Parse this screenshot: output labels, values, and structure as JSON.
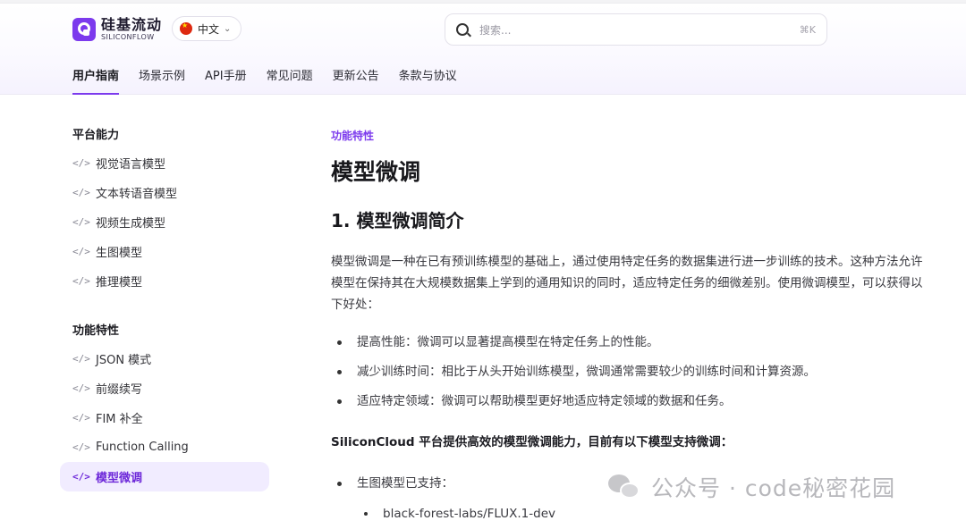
{
  "header": {
    "logo_cn": "硅基流动",
    "logo_en": "SILICONFLOW",
    "language": "中文",
    "search_placeholder": "搜索...",
    "search_shortcut": "⌘K",
    "tabs": [
      {
        "label": "用户指南",
        "active": true
      },
      {
        "label": "场景示例",
        "active": false
      },
      {
        "label": "API手册",
        "active": false
      },
      {
        "label": "常见问题",
        "active": false
      },
      {
        "label": "更新公告",
        "active": false
      },
      {
        "label": "条款与协议",
        "active": false
      }
    ]
  },
  "sidebar": {
    "section1": "平台能力",
    "section1_items": [
      "视觉语言模型",
      "文本转语音模型",
      "视频生成模型",
      "生图模型",
      "推理模型"
    ],
    "section2": "功能特性",
    "section2_items": [
      "JSON 模式",
      "前缀续写",
      "FIM 补全",
      "Function Calling",
      "模型微调"
    ],
    "code_icon": "</>"
  },
  "main": {
    "eyebrow": "功能特性",
    "title": "模型微调",
    "h2": "1. 模型微调简介",
    "para": "模型微调是一种在已有预训练模型的基础上，通过使用特定任务的数据集进行进一步训练的技术。这种方法允许模型在保持其在大规模数据集上学到的通用知识的同时，适应特定任务的细微差别。使用微调模型，可以获得以下好处：",
    "bullets": [
      "提高性能：微调可以显著提高模型在特定任务上的性能。",
      "减少训练时间：相比于从头开始训练模型，微调通常需要较少的训练时间和计算资源。",
      "适应特定领域：微调可以帮助模型更好地适应特定领域的数据和任务。"
    ],
    "bold_line": "SiliconCloud 平台提供高效的模型微调能力，目前有以下模型支持微调：",
    "support_item": "生图模型已支持：",
    "support_nested": "black-forest-labs/FLUX.1-dev"
  },
  "watermark": {
    "text": "公众号 · code秘密花园"
  },
  "colors": {
    "accent": "#7c3aed",
    "active_bg": "#f1ecff"
  }
}
